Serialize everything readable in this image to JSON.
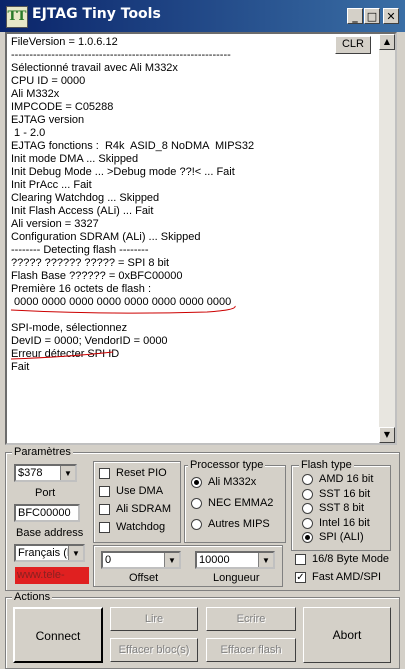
{
  "window": {
    "title": "EJTAG Tiny Tools",
    "controls": {
      "minimize": "_",
      "maximize": "□",
      "close": "✕"
    }
  },
  "log": {
    "clear_label": "CLR",
    "lines": [
      "FileVersion = 1.0.6.12",
      "------------------------------------------------------------",
      "Sélectionné travail avec Ali M332x",
      "CPU ID = 0000",
      "Ali M332x",
      "IMPCODE = C05288",
      "EJTAG version",
      " 1 - 2.0",
      "EJTAG fonctions :  R4k  ASID_8 NoDMA  MIPS32",
      "Init mode DMA ... Skipped",
      "Init Debug Mode ... >Debug mode ??!< ... Fait",
      "Init PrAcc ... Fait",
      "Clearing Watchdog ... Skipped",
      "Init Flash Access (ALi) ... Fait",
      "Ali version = 3327",
      "Configuration SDRAM (ALi) ... Skipped",
      "-------- Detecting flash --------",
      "????? ?????? ????? = SPI 8 bit",
      "Flash Base ?????? = 0xBFC00000",
      "Première 16 octets de flash :",
      " 0000 0000 0000 0000 0000 0000 0000 0000",
      "",
      "SPI-mode, sélectionnez",
      "DevID = 0000; VendorID = 0000",
      "Erreur détecter SPI ID",
      "Fait"
    ]
  },
  "parametres": {
    "title": "Paramètres",
    "port_value": "$378",
    "port_label": "Port",
    "base_address_value": "BFC00000",
    "base_address_label": "Base address",
    "language_value": "Français (F",
    "website": "www.tele-sat.ru",
    "checkboxes": [
      {
        "label": "Reset PIO",
        "checked": false
      },
      {
        "label": "Use DMA",
        "checked": false
      },
      {
        "label": "Ali SDRAM",
        "checked": false
      },
      {
        "label": "Watchdog",
        "checked": false
      }
    ],
    "offset_value": "0",
    "offset_label": "Offset",
    "longueur_value": "10000",
    "longueur_label": "Longueur"
  },
  "processor": {
    "title": "Processor type",
    "options": [
      {
        "label": "Ali M332x",
        "selected": true
      },
      {
        "label": "NEC EMMA2",
        "selected": false
      },
      {
        "label": "Autres MIPS",
        "selected": false
      }
    ]
  },
  "flash": {
    "title": "Flash type",
    "options": [
      {
        "label": "AMD 16 bit",
        "selected": false
      },
      {
        "label": "SST  16 bit",
        "selected": false
      },
      {
        "label": "SST    8 bit",
        "selected": false
      },
      {
        "label": "Intel  16 bit",
        "selected": false
      },
      {
        "label": "SPI  (ALI)",
        "selected": true
      }
    ]
  },
  "options": {
    "byte_mode": {
      "label": "16/8 Byte Mode",
      "checked": false
    },
    "fast_amd": {
      "label": "Fast AMD/SPI",
      "checked": true
    }
  },
  "actions": {
    "title": "Actions",
    "connect": "Connect",
    "lire": "Lire",
    "ecrire": "Ecrire",
    "effacer_blocs": "Effacer bloc(s)",
    "effacer_flash": "Effacer flash",
    "abort": "Abort"
  },
  "colors": {
    "title_bar": "#0a246a",
    "underline": "#cc0000",
    "link_bg": "#e02020"
  }
}
